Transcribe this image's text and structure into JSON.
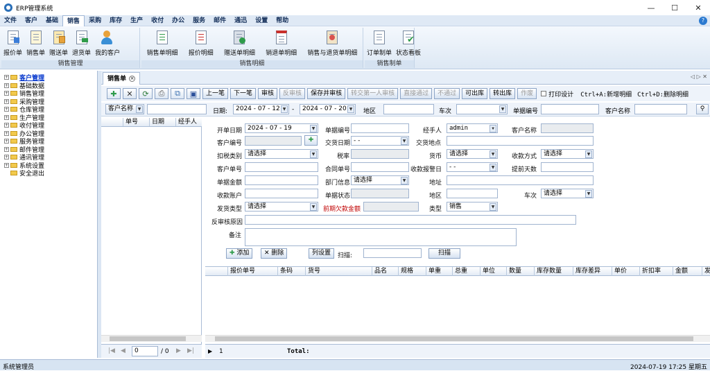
{
  "window": {
    "title": "ERP管理系统",
    "min": "—",
    "max": "☐",
    "close": "✕"
  },
  "menu": [
    "文件",
    "客户",
    "基础",
    "销售",
    "采购",
    "库存",
    "生产",
    "收付",
    "办公",
    "服务",
    "邮件",
    "通迅",
    "设置",
    "帮助"
  ],
  "menu_help_icon": "?",
  "ribbon": {
    "groups": [
      {
        "label": "销售管理",
        "buttons": [
          "报价单",
          "销售单",
          "赠送单",
          "退货单",
          "我的客户"
        ]
      },
      {
        "label": "销售明细",
        "buttons": [
          "销售单明细",
          "报价明细",
          "赠送单明细",
          "销退单明细",
          "销售与退货单明细"
        ]
      },
      {
        "label": "销售制单",
        "buttons": [
          "订单制单",
          "状态看板"
        ]
      }
    ]
  },
  "tree": [
    "客户管理",
    "基础数据",
    "销售管理",
    "采购管理",
    "仓库管理",
    "生产管理",
    "收付管理",
    "办公管理",
    "服务管理",
    "邮件管理",
    "通讯管理",
    "系统设置",
    "安全退出"
  ],
  "tab": {
    "label": "销售单",
    "nav": "◁ ▷ ✕"
  },
  "toolbar": {
    "buttons": [
      "上一笔",
      "下一笔",
      "审核",
      "反审核",
      "保存并审核",
      "转交第一人审核",
      "直接通过",
      "不通过",
      "可出库",
      "转出库",
      "作废"
    ],
    "print_design": "打印设计",
    "shortcut1": "Ctrl+A:新增明细",
    "shortcut2": "Ctrl+D:删除明细"
  },
  "filter": {
    "field_select": "客户名称",
    "date_label": "日期:",
    "date_from": "2024 - 07 - 12",
    "sep": "-",
    "date_to": "2024 - 07 - 20",
    "region": "地区",
    "vehicle": "车次",
    "doc_no": "单据编号",
    "cust_name": "客户名称"
  },
  "list_header": [
    "单号",
    "日期",
    "经手人"
  ],
  "form": {
    "open_date_label": "开单日期",
    "open_date": "2024 - 07 - 19",
    "doc_no_label": "单据编号",
    "handler_label": "经手人",
    "handler": "admin",
    "cust_name_label": "客户名称",
    "cust_no_label": "客户编号",
    "deliver_date_label": "交货日期",
    "deliver_date": "-  -",
    "deliver_place_label": "交货地点",
    "tax_type_label": "扣税类别",
    "tax_type": "请选择",
    "tax_rate_label": "税率",
    "currency_label": "货币",
    "currency": "请选择",
    "pay_method_label": "收款方式",
    "pay_method": "请选择",
    "cust_order_label": "客户单号",
    "contract_label": "合同单号",
    "pay_alert_label": "收款报警日",
    "pay_alert": "-  -",
    "advance_days_label": "提前天数",
    "amount_label": "单据金额",
    "dept_label": "部门信息",
    "dept": "请选择",
    "address_label": "地址",
    "account_label": "收款账户",
    "status_label": "单据状态",
    "region_label": "地区",
    "vehicle_label": "车次",
    "vehicle": "请选择",
    "ship_type_label": "发货类型",
    "ship_type": "请选择",
    "prev_debt_label": "前期欠款金额",
    "type_label": "类型",
    "type": "销售",
    "reason_label": "反审核原因",
    "remark_label": "备注",
    "add_btn": "添加",
    "del_btn": "删除",
    "colset_btn": "列设置",
    "scan_label": "扫描:",
    "scan_btn": "扫描"
  },
  "grid_headers": [
    "报价单号",
    "条码",
    "货号",
    "品名",
    "规格",
    "单重",
    "总重",
    "单位",
    "数量",
    "库存数量",
    "库存差异",
    "单价",
    "折扣率",
    "金额",
    "发"
  ],
  "pager": {
    "page": "0",
    "total": "/ 0"
  },
  "footer": {
    "row": "1",
    "total_label": "Total:"
  },
  "status": {
    "user": "系统管理员",
    "datetime": "2024-07-19 17:25 星期五"
  },
  "icons": [
    "add-icon",
    "delete-icon",
    "save-icon",
    "print-icon",
    "search-icon",
    "folder-icon",
    "plus-expand-icon"
  ]
}
